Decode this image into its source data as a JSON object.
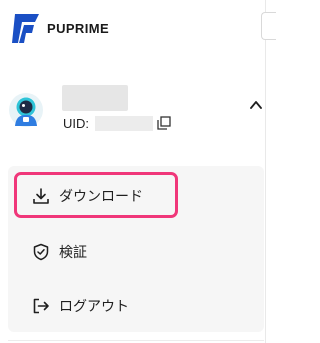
{
  "header": {
    "brand": "PUPRIME"
  },
  "profile": {
    "uid_label": "UID:"
  },
  "menu": {
    "items": [
      {
        "label": "ダウンロード",
        "icon": "download-icon"
      },
      {
        "label": "検証",
        "icon": "shield-check-icon"
      },
      {
        "label": "ログアウト",
        "icon": "logout-icon"
      }
    ]
  },
  "colors": {
    "brand_blue": "#1a4fc4",
    "highlight": "#f0377a",
    "panel_bg": "#f6f6f6"
  }
}
